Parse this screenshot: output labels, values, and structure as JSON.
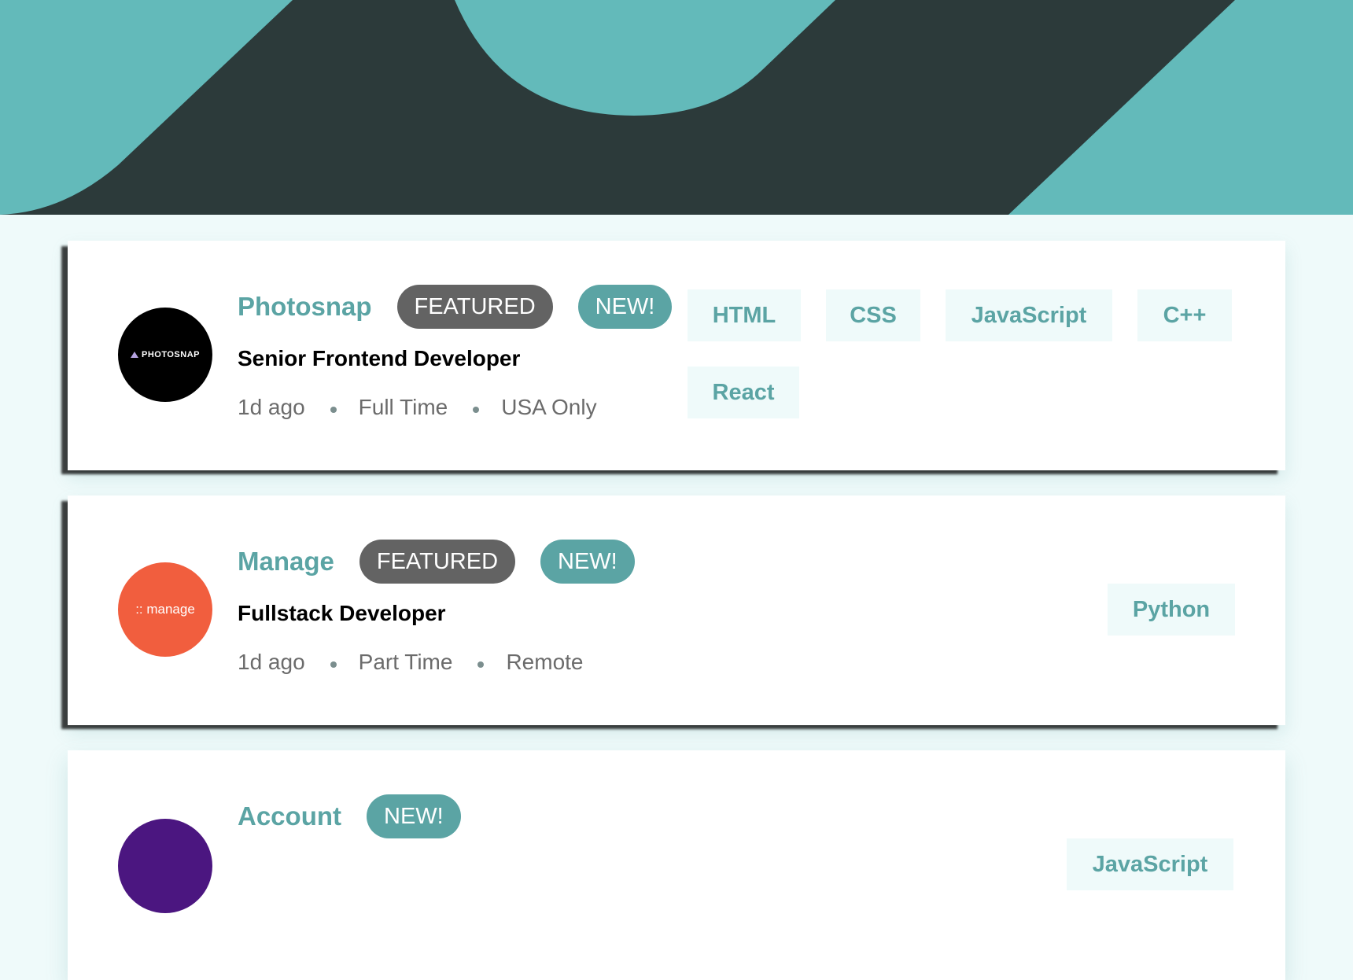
{
  "colors": {
    "primary": "#5ba4a4",
    "header_dark": "#2c3a3a",
    "background": "#effafa",
    "featured_badge": "#636363",
    "manage_logo": "#f15e3e",
    "photosnap_logo": "#000000",
    "account_logo": "#4b1680"
  },
  "jobs": [
    {
      "logo_text": "PHOTOSNAP",
      "logo_icon": "triangle-icon",
      "company": "Photosnap",
      "badges": {
        "featured": "FEATURED",
        "new": "NEW!"
      },
      "position": "Senior Frontend Developer",
      "posted": "1d ago",
      "contract": "Full Time",
      "location": "USA Only",
      "tags": [
        "HTML",
        "CSS",
        "JavaScript",
        "C++",
        "React"
      ]
    },
    {
      "logo_text": ":: manage",
      "company": "Manage",
      "badges": {
        "featured": "FEATURED",
        "new": "NEW!"
      },
      "position": "Fullstack Developer",
      "posted": "1d ago",
      "contract": "Part Time",
      "location": "Remote",
      "tags": [
        "Python"
      ]
    },
    {
      "company": "Account",
      "badges": {
        "new": "NEW!"
      },
      "tags": [
        "JavaScript"
      ]
    }
  ]
}
